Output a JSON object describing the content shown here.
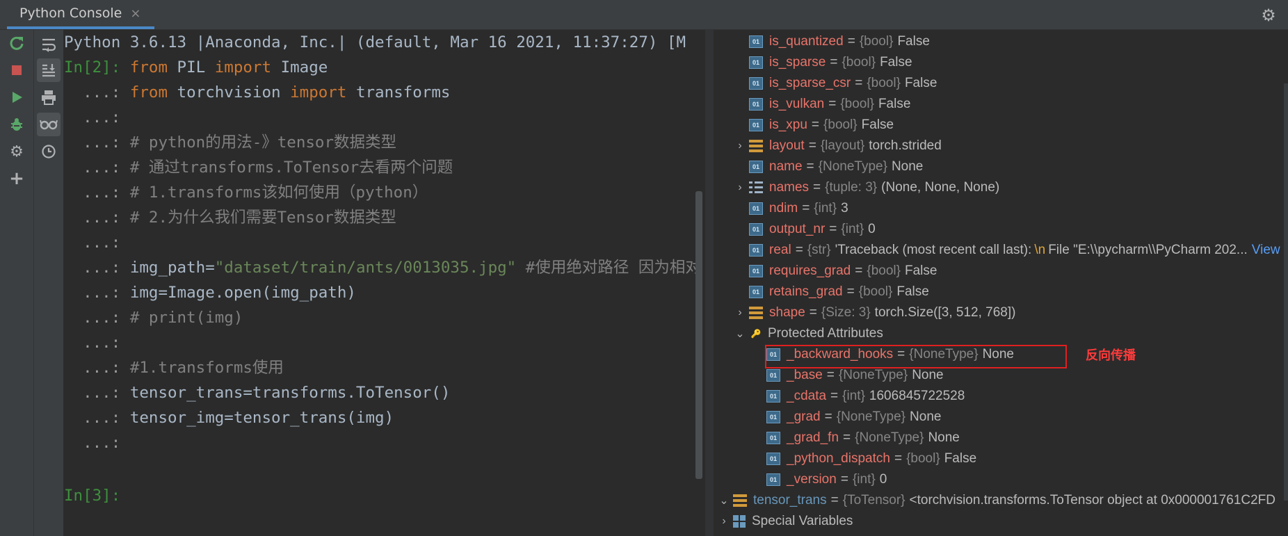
{
  "tab": {
    "title": "Python Console",
    "close": "×"
  },
  "toolbar": {
    "left": [
      {
        "name": "rerun-icon",
        "color": "#59a869"
      },
      {
        "name": "stop-icon",
        "color": "#c75450"
      },
      {
        "name": "run-icon",
        "color": "#59a869"
      },
      {
        "name": "debug-icon",
        "color": "#59a869"
      },
      {
        "name": "settings-icon",
        "color": "#afb1b3"
      },
      {
        "name": "add-icon",
        "color": "#afb1b3"
      }
    ],
    "right": [
      {
        "name": "soft-wrap-icon"
      },
      {
        "name": "scroll-to-end-icon",
        "active": true
      },
      {
        "name": "print-icon"
      },
      {
        "name": "show-variables-icon",
        "active": true
      },
      {
        "name": "history-icon"
      }
    ]
  },
  "console": {
    "lines": [
      [
        {
          "t": "Python 3.6.13 |Anaconda, Inc.| (default, Mar 16 2021, 11:37:27) [M",
          "c": "plain"
        }
      ],
      [
        {
          "t": "In[2]: ",
          "c": "prompt"
        },
        {
          "t": "from",
          "c": "kw"
        },
        {
          "t": " PIL ",
          "c": "plain"
        },
        {
          "t": "import",
          "c": "kw"
        },
        {
          "t": " Image",
          "c": "plain"
        }
      ],
      [
        {
          "t": "  ...: ",
          "c": "cont"
        },
        {
          "t": "from",
          "c": "kw"
        },
        {
          "t": " torchvision ",
          "c": "plain"
        },
        {
          "t": "import",
          "c": "kw"
        },
        {
          "t": " transforms",
          "c": "plain"
        }
      ],
      [
        {
          "t": "  ...:",
          "c": "cont"
        }
      ],
      [
        {
          "t": "  ...: ",
          "c": "cont"
        },
        {
          "t": "# python的用法-》tensor数据类型",
          "c": "cmt"
        }
      ],
      [
        {
          "t": "  ...: ",
          "c": "cont"
        },
        {
          "t": "# 通过transforms.ToTensor去看两个问题",
          "c": "cmt"
        }
      ],
      [
        {
          "t": "  ...: ",
          "c": "cont"
        },
        {
          "t": "# 1.transforms该如何使用（python）",
          "c": "cmt"
        }
      ],
      [
        {
          "t": "  ...: ",
          "c": "cont"
        },
        {
          "t": "# 2.为什么我们需要Tensor数据类型",
          "c": "cmt"
        }
      ],
      [
        {
          "t": "  ...:",
          "c": "cont"
        }
      ],
      [
        {
          "t": "  ...: ",
          "c": "cont"
        },
        {
          "t": "img_path=",
          "c": "plain"
        },
        {
          "t": "\"dataset/train/ants/0013035.jpg\"",
          "c": "str"
        },
        {
          "t": " #使用绝对路径 因为相对",
          "c": "cmt"
        }
      ],
      [
        {
          "t": "  ...: ",
          "c": "cont"
        },
        {
          "t": "img=Image.open(img_path)",
          "c": "plain"
        }
      ],
      [
        {
          "t": "  ...: ",
          "c": "cont"
        },
        {
          "t": "# print(img)",
          "c": "cmt"
        }
      ],
      [
        {
          "t": "  ...:",
          "c": "cont"
        }
      ],
      [
        {
          "t": "  ...: ",
          "c": "cont"
        },
        {
          "t": "#1.transforms使用",
          "c": "cmt"
        }
      ],
      [
        {
          "t": "  ...: ",
          "c": "cont"
        },
        {
          "t": "tensor_trans=transforms.ToTensor()",
          "c": "plain"
        }
      ],
      [
        {
          "t": "  ...: ",
          "c": "cont"
        },
        {
          "t": "tensor_img=tensor_trans(img)",
          "c": "plain"
        }
      ],
      [
        {
          "t": "  ...:",
          "c": "cont"
        }
      ],
      [
        {
          "t": "",
          "c": "plain"
        }
      ],
      [
        {
          "t": "In[3]:",
          "c": "prompt"
        }
      ]
    ]
  },
  "variables": [
    {
      "name": "is_quantized",
      "type": "{bool}",
      "value": "False",
      "icon": "01",
      "indent": 1
    },
    {
      "name": "is_sparse",
      "type": "{bool}",
      "value": "False",
      "icon": "01",
      "indent": 1
    },
    {
      "name": "is_sparse_csr",
      "type": "{bool}",
      "value": "False",
      "icon": "01",
      "indent": 1
    },
    {
      "name": "is_vulkan",
      "type": "{bool}",
      "value": "False",
      "icon": "01",
      "indent": 1
    },
    {
      "name": "is_xpu",
      "type": "{bool}",
      "value": "False",
      "icon": "01",
      "indent": 1
    },
    {
      "name": "layout",
      "type": "{layout}",
      "value": "torch.strided",
      "icon": "stack",
      "indent": 1,
      "arrow": "›"
    },
    {
      "name": "name",
      "type": "{NoneType}",
      "value": "None",
      "icon": "01",
      "indent": 1
    },
    {
      "name": "names",
      "type": "{tuple: 3}",
      "value": "(None, None, None)",
      "icon": "tuple",
      "indent": 1,
      "arrow": "›"
    },
    {
      "name": "ndim",
      "type": "{int}",
      "value": "3",
      "icon": "01",
      "indent": 1
    },
    {
      "name": "output_nr",
      "type": "{int}",
      "value": "0",
      "icon": "01",
      "indent": 1
    },
    {
      "name": "real",
      "type": "{str}",
      "value": "'Traceback (most recent call last):",
      "nl": "\\n",
      "value2": "  File \"E:\\\\pycharm\\\\PyCharm 202...",
      "view": "View",
      "icon": "01",
      "indent": 1
    },
    {
      "name": "requires_grad",
      "type": "{bool}",
      "value": "False",
      "icon": "01",
      "indent": 1
    },
    {
      "name": "retains_grad",
      "type": "{bool}",
      "value": "False",
      "icon": "01",
      "indent": 1
    },
    {
      "name": "shape",
      "type": "{Size: 3}",
      "value": "torch.Size([3, 512, 768])",
      "icon": "stack",
      "indent": 1,
      "arrow": "›"
    },
    {
      "name": "Protected Attributes",
      "type": "",
      "value": "",
      "icon": "lock",
      "indent": 1,
      "arrow": "⌄",
      "group": true
    },
    {
      "name": "_backward_hooks",
      "type": "{NoneType}",
      "value": "None",
      "icon": "01",
      "indent": 2
    },
    {
      "name": "_base",
      "type": "{NoneType}",
      "value": "None",
      "icon": "01",
      "indent": 2
    },
    {
      "name": "_cdata",
      "type": "{int}",
      "value": "1606845722528",
      "icon": "01",
      "indent": 2
    },
    {
      "name": "_grad",
      "type": "{NoneType}",
      "value": "None",
      "icon": "01",
      "indent": 2
    },
    {
      "name": "_grad_fn",
      "type": "{NoneType}",
      "value": "None",
      "icon": "01",
      "indent": 2
    },
    {
      "name": "_python_dispatch",
      "type": "{bool}",
      "value": "False",
      "icon": "01",
      "indent": 2
    },
    {
      "name": "_version",
      "type": "{int}",
      "value": "0",
      "icon": "01",
      "indent": 2
    },
    {
      "name": "tensor_trans",
      "type": "{ToTensor}",
      "value": "<torchvision.transforms.ToTensor object at 0x000001761C2FD",
      "icon": "stack",
      "indent": 0,
      "arrow": "⌄",
      "blue": true
    },
    {
      "name": "Special Variables",
      "type": "",
      "value": "",
      "icon": "grid",
      "indent": 0,
      "arrow": "›",
      "group": true
    }
  ],
  "annotation": "反向传播"
}
